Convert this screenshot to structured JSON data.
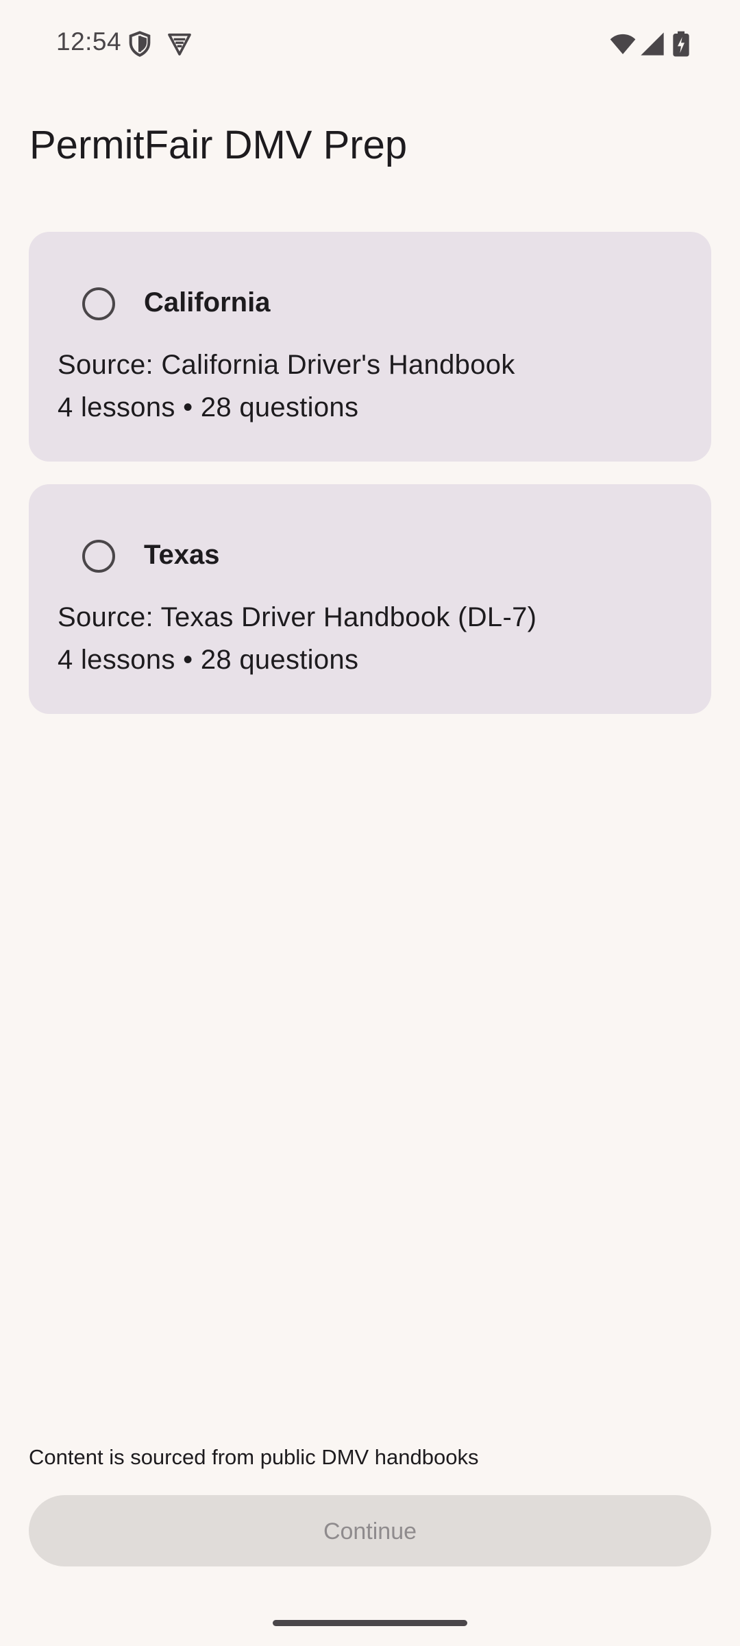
{
  "status_bar": {
    "time": "12:54",
    "left_icons": [
      "shield-icon",
      "vpn-badge-icon"
    ],
    "right_icons": [
      "wifi-icon",
      "cell-signal-icon",
      "battery-charging-icon"
    ]
  },
  "app": {
    "title": "PermitFair DMV Prep"
  },
  "states": [
    {
      "name": "California",
      "source": "Source: California Driver's Handbook",
      "meta": "4 lessons • 28 questions",
      "selected": false
    },
    {
      "name": "Texas",
      "source": "Source: Texas Driver Handbook (DL-7)",
      "meta": "4 lessons • 28 questions",
      "selected": false
    }
  ],
  "footer": {
    "note": "Content is sourced from public DMV handbooks",
    "continue_label": "Continue",
    "continue_enabled": false
  },
  "colors": {
    "background": "#faf6f3",
    "card": "#e8e1e8",
    "button_disabled": "#e0dcd9",
    "text": "#1d1b1e"
  }
}
